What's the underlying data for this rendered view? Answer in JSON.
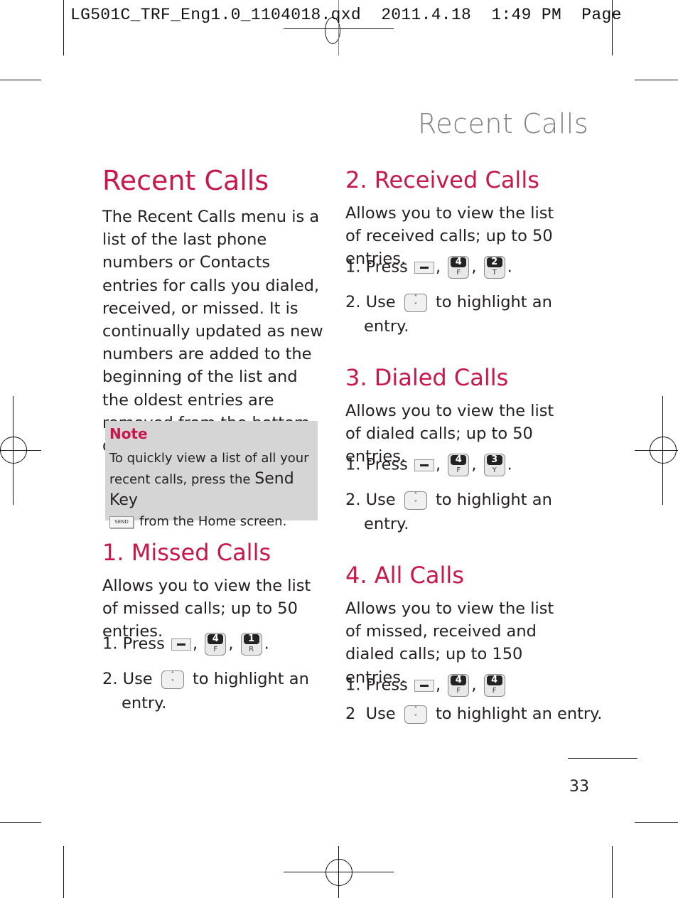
{
  "slug": {
    "filename": "LG501C_TRF_Eng1.0_1104018.qxd",
    "date": "2011.4.18",
    "time": "1:49 PM",
    "page_label": "Page"
  },
  "running_header": "Recent Calls",
  "main_title": "Recent Calls",
  "intro": "The Recent Calls menu is a list of the last phone numbers or Contacts entries for calls you dialed, received, or missed. It is continually updated as new numbers are added to the beginning of the list and the oldest entries are removed from the bottom of the list.",
  "note": {
    "title": "Note",
    "text_before": "To quickly view a list of all your recent calls, press the",
    "key_name": "Send Key",
    "key_glyph": "SEND",
    "text_after": "from the Home screen."
  },
  "sections": [
    {
      "title": "1. Missed Calls",
      "description": "Allows you to view the list of missed calls; up to 50 entries.",
      "step1_prefix": "1. Press",
      "keys": [
        {
          "digit": "4",
          "letter": "F"
        },
        {
          "digit": "1",
          "letter": "R"
        }
      ],
      "step2_prefix": "2. Use",
      "step2_suffix": "to highlight an",
      "step2_cont": "entry."
    },
    {
      "title": "2. Received Calls",
      "description": "Allows you to view the list of received calls; up to 50 entries.",
      "step1_prefix": "1. Press",
      "keys": [
        {
          "digit": "4",
          "letter": "F"
        },
        {
          "digit": "2",
          "letter": "T"
        }
      ],
      "step2_prefix": "2. Use",
      "step2_suffix": "to highlight an",
      "step2_cont": "entry."
    },
    {
      "title": "3. Dialed Calls",
      "description": "Allows you to view the list of dialed calls; up to 50 entries.",
      "step1_prefix": "1. Press",
      "keys": [
        {
          "digit": "4",
          "letter": "F"
        },
        {
          "digit": "3",
          "letter": "Y"
        }
      ],
      "step2_prefix": "2. Use",
      "step2_suffix": "to highlight an",
      "step2_cont": "entry."
    },
    {
      "title": "4. All Calls",
      "description": "Allows you to view the list of missed, received and dialed calls; up to 150 entries.",
      "step1_prefix": "1. Press",
      "keys": [
        {
          "digit": "4",
          "letter": "F"
        },
        {
          "digit": "4",
          "letter": "F"
        }
      ],
      "step2_prefix": "2  Use",
      "step2_suffix": "to highlight an entry.",
      "step2_cont": ""
    }
  ],
  "punct": {
    "comma": ",",
    "period": "."
  },
  "nav_key_glyph": {
    "up": "˄",
    "down": "˅"
  },
  "page_number": "33"
}
